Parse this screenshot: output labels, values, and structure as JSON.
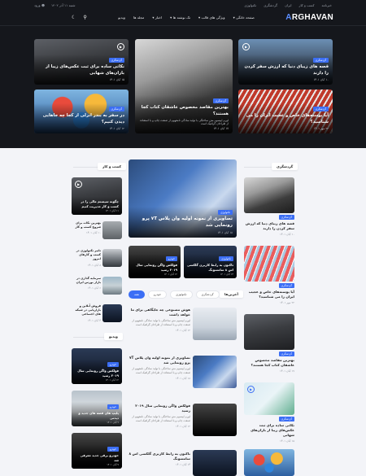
{
  "topbar": {
    "links": [
      "خبرنامه",
      "کسب و کار",
      "ایران",
      "گردشگری",
      "تکنولوژی"
    ],
    "date": "شنبه ۱۱ آذر ۱۴۰۲",
    "login": "ورود"
  },
  "header": {
    "logo_prefix": "A",
    "logo_rest": "RGHAVAN",
    "nav": [
      "صفحه خانگی",
      "ویژگی های قالب",
      "تک نوشته ها",
      "اخبار",
      "مجله ها",
      "ویدیو"
    ],
    "icons": [
      "search-icon",
      "moon-icon"
    ]
  },
  "hero": {
    "right_top": {
      "tag": "گردشگری",
      "title": "قصه های زیبای دنیا که ارزش سفر کردن را دارند",
      "date": "۱۰ آبان ۱۴۰۱"
    },
    "right_bottom": {
      "tag": "گردشگری",
      "title": "آیا پوسته‌های خاص و عجیب ایران را می شناسید؟",
      "date": "۲۲ مهر ۱۴۰۱"
    },
    "center": {
      "tag": "گردشگری",
      "title": "بهترین مقاصد مخصوص عاشقان کتاب کجا هستند؟",
      "excerpt": "لورم ایپسوم متن ساختگی با تولید سادگی نامفهوم از صنعت چاپ و با استفاده از طراحان گرافیک است",
      "date": "۱۷ آبان ۱۴۰۱"
    },
    "left_top": {
      "tag": "گردشگری",
      "title": "نکاتی ساده برای ثبت عکس‌های زیبا از باران‌های شهابی",
      "date": "۱۵ آبان ۱۴۰۱"
    },
    "left_bottom": {
      "tag": "گردشگری",
      "title": "در سفر به بندر انزلی از کجا چه جاهایی دیدن کنیم؟",
      "date": "۱۲ آبان ۱۴۰۱"
    }
  },
  "right_col": {
    "title": "گردشگری",
    "items": [
      {
        "tag": "گردشگری",
        "title": "قصه های زیبای دنیا که ارزش سفر کردن را دارند",
        "date": "۱۰ آبان ۱۴۰۱"
      },
      {
        "tag": "گردشگری",
        "title": "آیا پوسته‌های خاص و عجیب ایران را می شناسید؟",
        "date": "۲۲ مهر ۱۴۰۱"
      },
      {
        "tag": "گردشگری",
        "title": "بهترین مقاصد مخصوص عاشقان کتاب کجا هستند؟",
        "date": "۱۷ آبان ۱۴۰۱"
      },
      {
        "tag": "گردشگری",
        "title": "نکاتی ساده برای ثبت عکس‌های زیبا از باران‌های شهابی",
        "date": "۱۵ آبان ۱۴۰۱"
      }
    ]
  },
  "center_col": {
    "feature": {
      "tag": "تکنولوژی",
      "title": "تصاویری از نمونه اولیه وان پلاس ۷T پرو رونمایی شد",
      "date": "۱۸ آبان ۱۴۰۱"
    },
    "pair": [
      {
        "tag": "تکنولوژی",
        "title": "تاکنون به رابط کاربری گلکسی اس ۸ سامسونگ",
        "date": "۱۴ آبان ۱۴۰۱"
      },
      {
        "tag": "خودرو",
        "title": "فولکس واگن رونمایی سال ۲۰۱۹ رسید",
        "date": "۱۲ آبان ۱۴۰۱"
      }
    ],
    "tabs_title": "آخرین‌ها",
    "tabs": [
      "همه",
      "خودرو",
      "تکنولوژی",
      "گردشگری",
      "ویدیو"
    ],
    "list": [
      {
        "title": "هوش مصنوعی چه جایگاهی برای ما خواهد داشت",
        "excerpt": "لورم ایپسوم متن ساختگی با تولید سادگی نامفهوم از صنعت چاپ و با استفاده از طراحان گرافیک است",
        "date": "۱۲ آبان ۱۴۰۱"
      },
      {
        "title": "تصاویری از نمونه اولیه وان پلاس ۷T پرو رونمایی شد",
        "excerpt": "لورم ایپسوم متن ساختگی با تولید سادگی نامفهوم از صنعت چاپ و با استفاده از طراحان گرافیک است",
        "date": "۱۸ آبان ۱۴۰۱"
      },
      {
        "title": "فولکس واگن رونمایی سال ۲۰۱۹ رسید",
        "excerpt": "لورم ایپسوم متن ساختگی با تولید سادگی نامفهوم از صنعت چاپ و با استفاده از طراحان گرافیک است",
        "date": "۱۲ آبان ۱۴۰۱"
      },
      {
        "title": "تاکنون به رابط کاربری گلکسی اس ۸ سامسونگ",
        "excerpt": "لورم ایپسوم متن ساختگی با تولید سادگی",
        "date": "۱۴ آبان ۱۴۰۱"
      }
    ]
  },
  "left_col": {
    "title": "کسب و کار",
    "feature": {
      "title": "چگونه سیستم مالی را در کسب و کار مدیریت کنیم",
      "date": "۱۱ آبان ۱۴۰۱"
    },
    "small": [
      {
        "title": "بهترین نکات برای شروع کسب و کار",
        "date": "۱۰ آبان ۱۴۰۱"
      },
      {
        "title": "تاثیر تکنولوژی در کسب و کارهای امروز",
        "date": "۸ آبان ۱۴۰۱"
      },
      {
        "title": "سرمایه گذاری در بازار بورس ایران",
        "date": "۶ آبان ۱۴۰۱"
      },
      {
        "title": "فروش آنلاین و بازاریابی در شبکه های اجتماعی",
        "date": "۴ آبان ۱۴۰۱"
      }
    ],
    "section2_title": "ویدیو",
    "videos": [
      {
        "tag": "خودرو",
        "title": "فولکس واگن رونمایی سال ۲۰۱۹ رسید",
        "date": "۱۲ آبان ۱۴۰۱"
      },
      {
        "tag": "خودرو",
        "title": "پلیپ های قصه های جدید و دیدنی",
        "date": "۹ آبان ۱۴۰۱"
      },
      {
        "tag": "خودرو",
        "title": "خودرو برقی جدید معرفی شد",
        "date": "۷ آبان ۱۴۰۱"
      }
    ]
  }
}
